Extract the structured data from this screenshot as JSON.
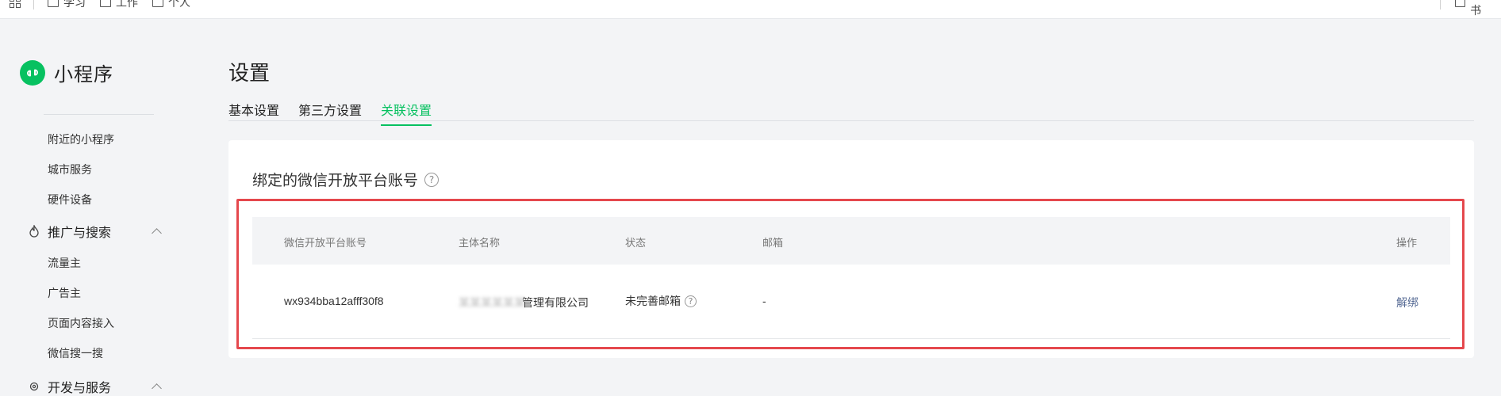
{
  "bookmarks": {
    "items": [
      "学习",
      "工作",
      "个人"
    ],
    "right_label": "所有书"
  },
  "sidebar": {
    "app_name": "小程序",
    "items": {
      "nearby": "附近的小程序",
      "city": "城市服务",
      "hardware": "硬件设备"
    },
    "group_promo": {
      "label": "推广与搜索",
      "icon": "fire-icon"
    },
    "promo_items": {
      "traffic": "流量主",
      "advertiser": "广告主",
      "page_content": "页面内容接入",
      "wechat_search": "微信搜一搜"
    },
    "group_dev": {
      "label": "开发与服务",
      "icon": "gear-icon"
    }
  },
  "main": {
    "title": "设置",
    "tabs": {
      "basic": "基本设置",
      "third_party": "第三方设置",
      "linked": "关联设置"
    },
    "active_tab": "linked",
    "card": {
      "title": "绑定的微信开放平台账号",
      "help_icon": "question-circle-icon",
      "columns": {
        "account": "微信开放平台账号",
        "entity": "主体名称",
        "status": "状态",
        "email": "邮箱",
        "action": "操作"
      },
      "row": {
        "account": "wx934bba12afff30f8",
        "entity_blurred": "某某某某某某",
        "entity_visible": "管理有限公司",
        "status": "未完善邮箱",
        "email": "-",
        "action": "解绑"
      }
    }
  },
  "colors": {
    "brand_green": "#07c160",
    "highlight_red": "#e5484d",
    "link_blue": "#576b95"
  }
}
